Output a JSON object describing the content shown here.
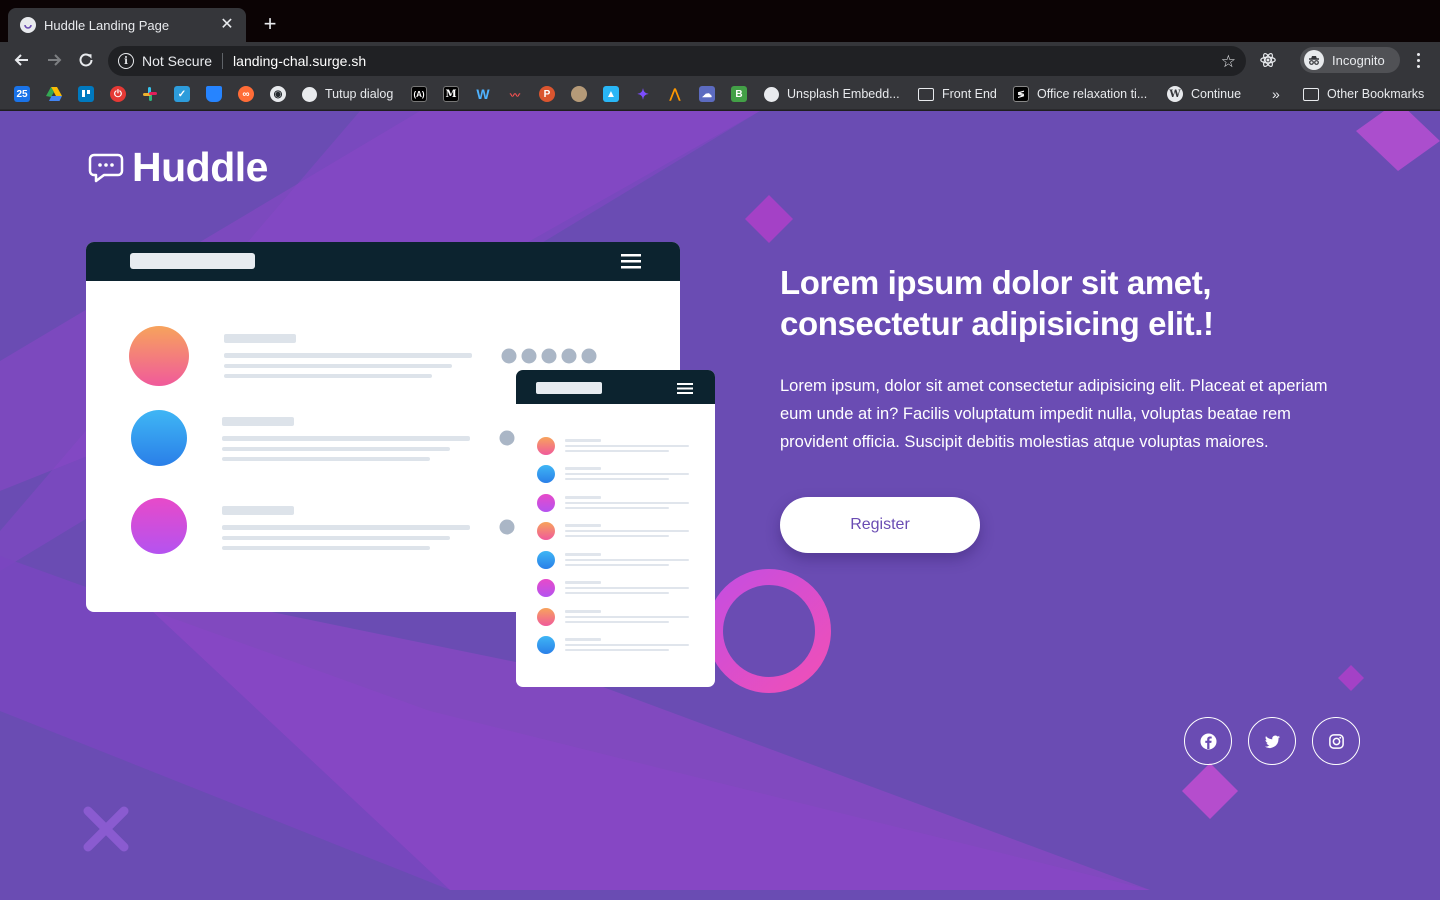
{
  "browser": {
    "tab_title": "Huddle Landing Page",
    "security_label": "Not Secure",
    "url": "landing-chal.surge.sh",
    "profile_label": "Incognito",
    "bookmarks": [
      {
        "label": "Tutup dialog",
        "icon": "globe-icon"
      },
      {
        "label": "Unsplash Embedd...",
        "icon": "globe-icon"
      },
      {
        "label": "Front End",
        "icon": "folder-icon"
      },
      {
        "label": "Office relaxation ti...",
        "icon": "code-icon"
      },
      {
        "label": "Continue",
        "icon": "wordpress-icon"
      },
      {
        "label": "Other Bookmarks",
        "icon": "folder-icon"
      }
    ],
    "bookmark_icon_colors": {
      "calendar": "#1a73e8",
      "drive": "#34a853",
      "trello": "#0079bf",
      "power": "#e53935",
      "slack": "#4a154b",
      "todo": "#2d9cdb",
      "bitbucket": "#2684ff",
      "postman": "#ff6c37",
      "medium": "#000000",
      "webflow": "#4353ff"
    }
  },
  "page": {
    "brand": "Huddle",
    "headline": "Lorem ipsum dolor sit amet, consectetur adipisicing elit.!",
    "body": "Lorem ipsum, dolor sit amet consectetur adipisicing elit. Placeat et aperiam eum unde at in? Facilis voluptatum impedit nulla, voluptas beatae rem provident officia. Suscipit debitis molestias atque voluptas maiores.",
    "cta_label": "Register",
    "social_links": [
      "facebook-icon",
      "twitter-icon",
      "instagram-icon"
    ]
  },
  "colors": {
    "background": "#6a4cb3",
    "accent_shape": "#a64ac9",
    "button_text": "#6a4cb3",
    "mockup_header": "#0c232f"
  }
}
